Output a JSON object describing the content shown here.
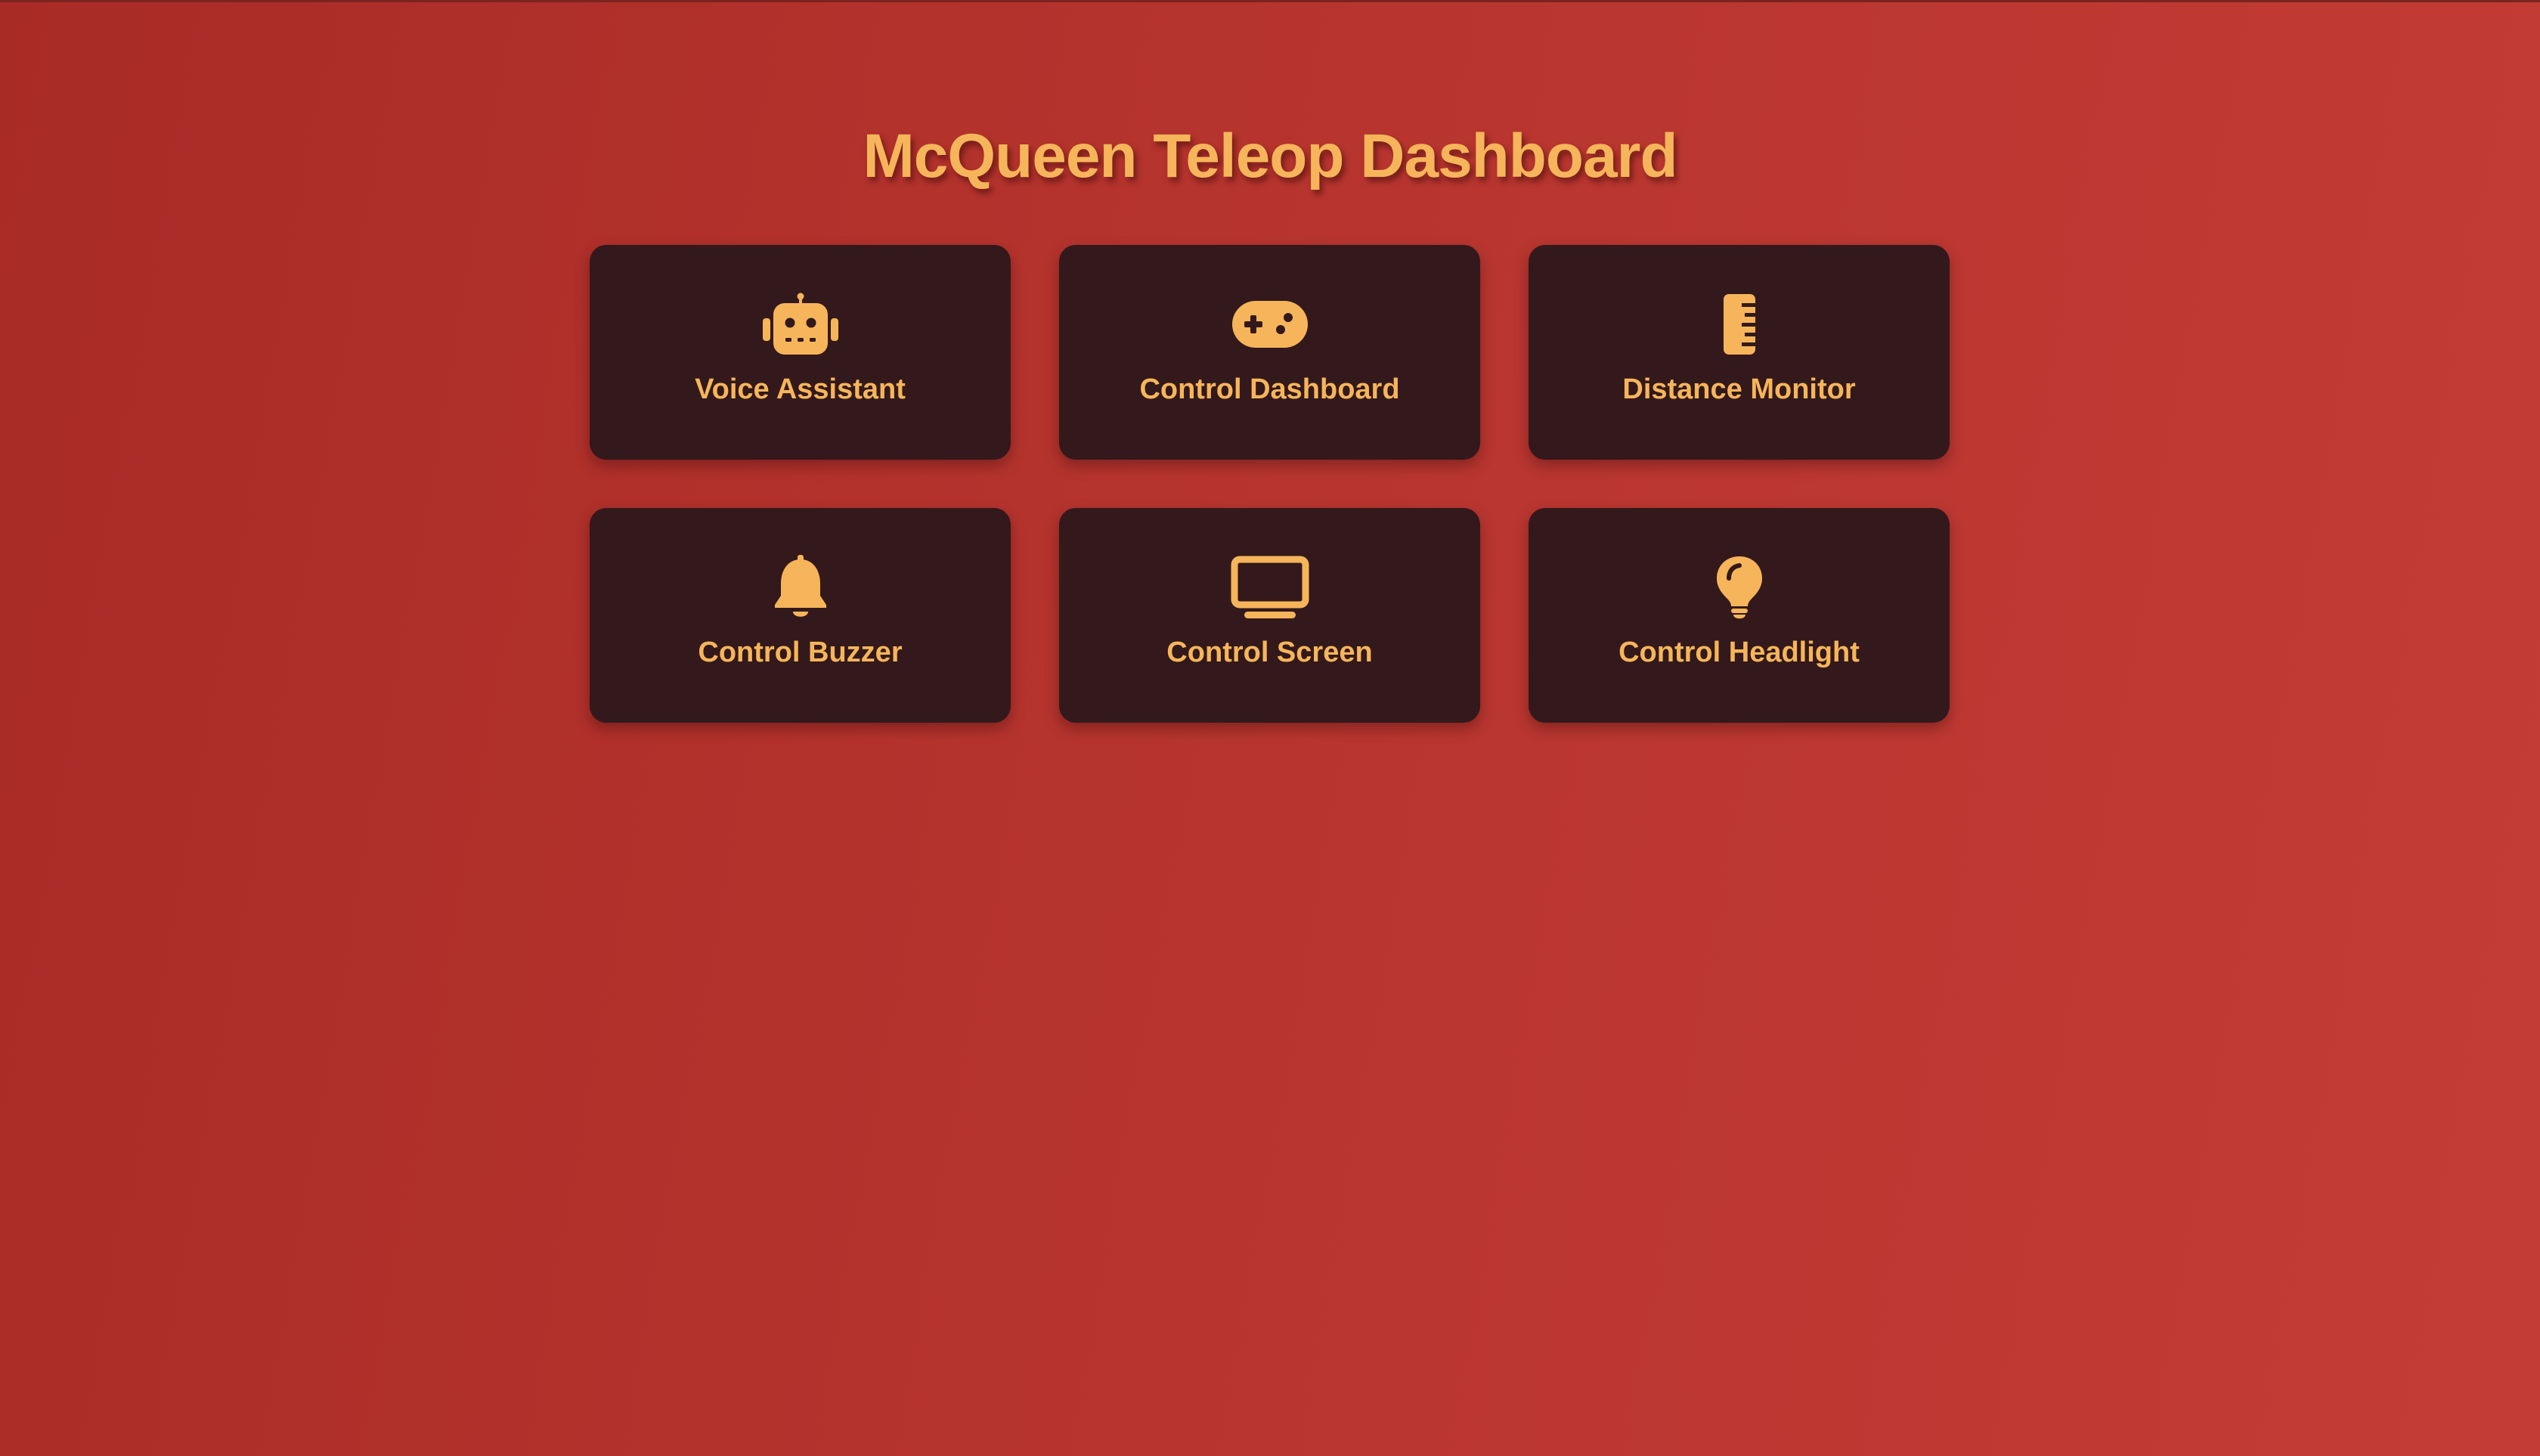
{
  "page": {
    "title": "McQueen Teleop Dashboard",
    "accent_color": "#f6b55a",
    "card_color": "#33191b",
    "background_color": "#b8352f"
  },
  "cards": [
    {
      "label": "Voice Assistant",
      "icon": "robot-icon"
    },
    {
      "label": "Control Dashboard",
      "icon": "gamepad-icon"
    },
    {
      "label": "Distance Monitor",
      "icon": "ruler-icon"
    },
    {
      "label": "Control Buzzer",
      "icon": "bell-icon"
    },
    {
      "label": "Control Screen",
      "icon": "monitor-icon"
    },
    {
      "label": "Control Headlight",
      "icon": "lightbulb-icon"
    }
  ]
}
